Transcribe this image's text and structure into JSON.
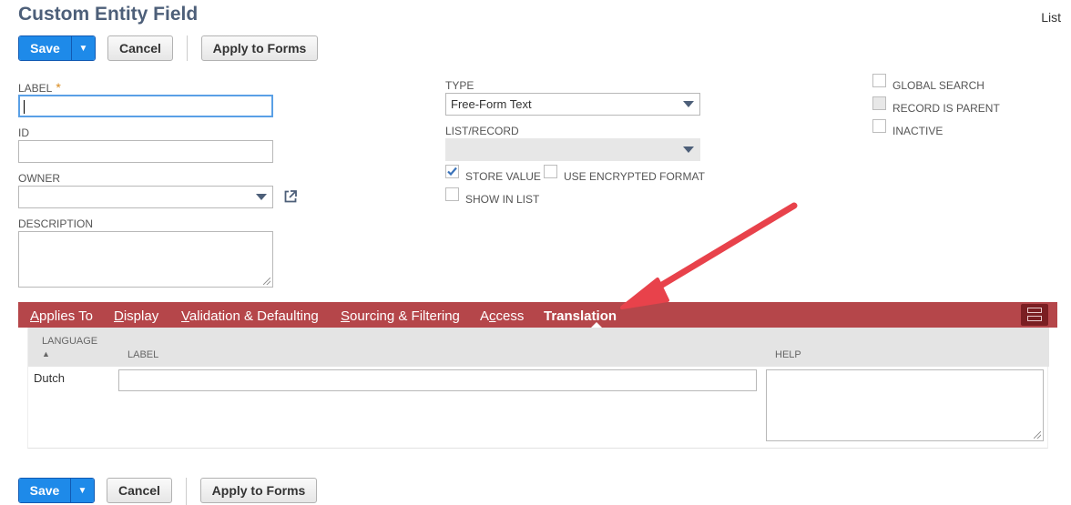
{
  "page": {
    "title": "Custom Entity Field",
    "list_link": "List"
  },
  "toolbar": {
    "save_label": "Save",
    "save_menu_glyph": "▼",
    "cancel_label": "Cancel",
    "apply_label": "Apply to Forms"
  },
  "form": {
    "label": {
      "caption": "LABEL",
      "required_mark": "*",
      "value": ""
    },
    "id": {
      "caption": "ID",
      "value": ""
    },
    "owner": {
      "caption": "OWNER",
      "value": ""
    },
    "description": {
      "caption": "DESCRIPTION",
      "value": ""
    },
    "type": {
      "caption": "TYPE",
      "value": "Free-Form Text"
    },
    "list_record": {
      "caption": "LIST/RECORD",
      "value": ""
    },
    "checkboxes": {
      "store_value": {
        "caption": "STORE VALUE",
        "checked": true
      },
      "use_encrypted": {
        "caption": "USE ENCRYPTED FORMAT",
        "checked": false
      },
      "show_in_list": {
        "caption": "SHOW IN LIST",
        "checked": false
      },
      "global_search": {
        "caption": "GLOBAL SEARCH",
        "checked": false
      },
      "record_is_parent": {
        "caption": "RECORD IS PARENT",
        "checked": false
      },
      "inactive": {
        "caption": "INACTIVE",
        "checked": false
      }
    }
  },
  "tabs": [
    {
      "pre": "",
      "key": "A",
      "post": "pplies To"
    },
    {
      "pre": "",
      "key": "D",
      "post": "isplay"
    },
    {
      "pre": "",
      "key": "V",
      "post": "alidation & Defaulting"
    },
    {
      "pre": "",
      "key": "S",
      "post": "ourcing & Filtering"
    },
    {
      "pre": "A",
      "key": "c",
      "post": "cess"
    },
    {
      "pre": "",
      "key": "",
      "post": "Translation"
    }
  ],
  "translation": {
    "columns": {
      "language": "LANGUAGE",
      "sort_glyph": "▲",
      "label": "LABEL",
      "help": "HELP"
    },
    "rows": [
      {
        "language": "Dutch",
        "label": "",
        "help": ""
      }
    ]
  },
  "colors": {
    "title": "#4d5f79",
    "save_blue": "#1e8ae9",
    "tab_bar": "#b5464a",
    "annotation_arrow": "#e8424b"
  }
}
